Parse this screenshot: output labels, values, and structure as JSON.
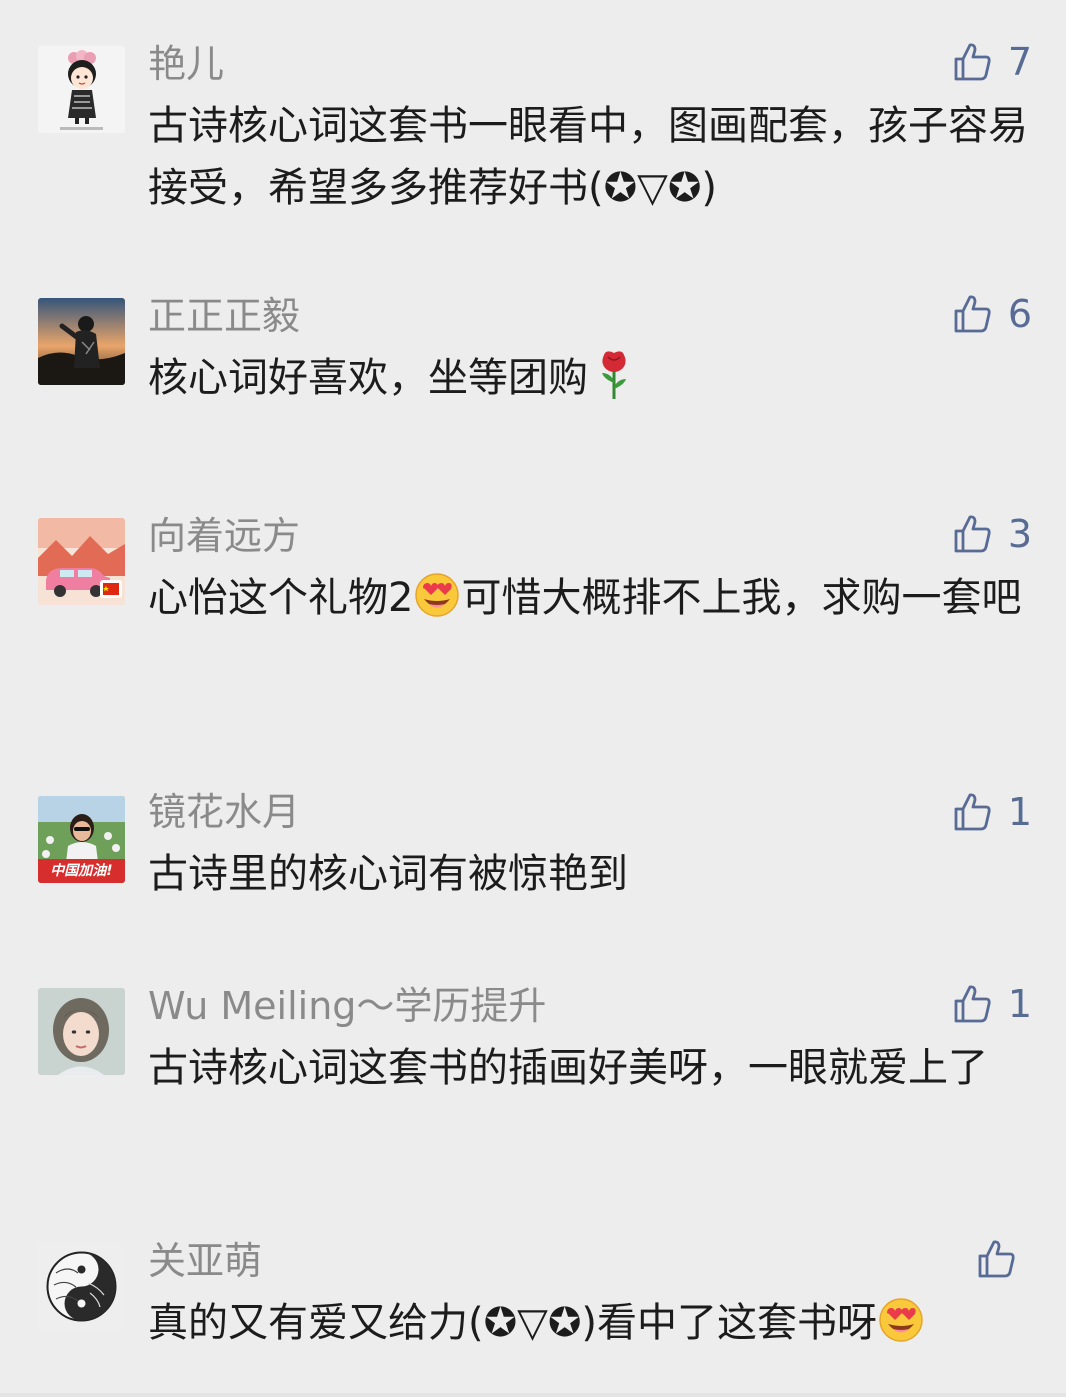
{
  "colors": {
    "background": "#ededed",
    "nickname": "#8a8a8a",
    "text": "#1c1c1c",
    "like": "#576b95"
  },
  "comments": [
    {
      "nickname": "艳儿",
      "text": "古诗核心词这套书一眼看中，图画配套，孩子容易接受，希望多多推荐好书(✪▽✪)",
      "likes": "7",
      "avatar_icon": "cartoon-girl-avatar"
    },
    {
      "nickname": "正正正毅",
      "text": "核心词好喜欢，坐等团购",
      "likes": "6",
      "avatar_icon": "sunset-silhouette-avatar",
      "trailing_emoji": "rose-emoji"
    },
    {
      "nickname": "向着远方",
      "text_before": "心怡这个礼物2",
      "text_after": "可惜大概排不上我，求购一套吧",
      "likes": "3",
      "avatar_icon": "pink-car-avatar",
      "inline_emoji": "heart-eyes-emoji"
    },
    {
      "nickname": "镜花水月",
      "text": "古诗里的核心词有被惊艳到",
      "likes": "1",
      "avatar_icon": "woman-flower-field-avatar",
      "avatar_caption": "中国加油!"
    },
    {
      "nickname": "Wu Meiling～学历提升",
      "text": "古诗核心词这套书的插画好美呀，一眼就爱上了",
      "likes": "1",
      "avatar_icon": "woman-portrait-avatar"
    },
    {
      "nickname": "关亚萌",
      "text": "真的又有爱又给力(✪▽✪)看中了这套书呀",
      "likes": "",
      "avatar_icon": "ink-circle-avatar",
      "trailing_emoji": "heart-eyes-emoji"
    }
  ]
}
